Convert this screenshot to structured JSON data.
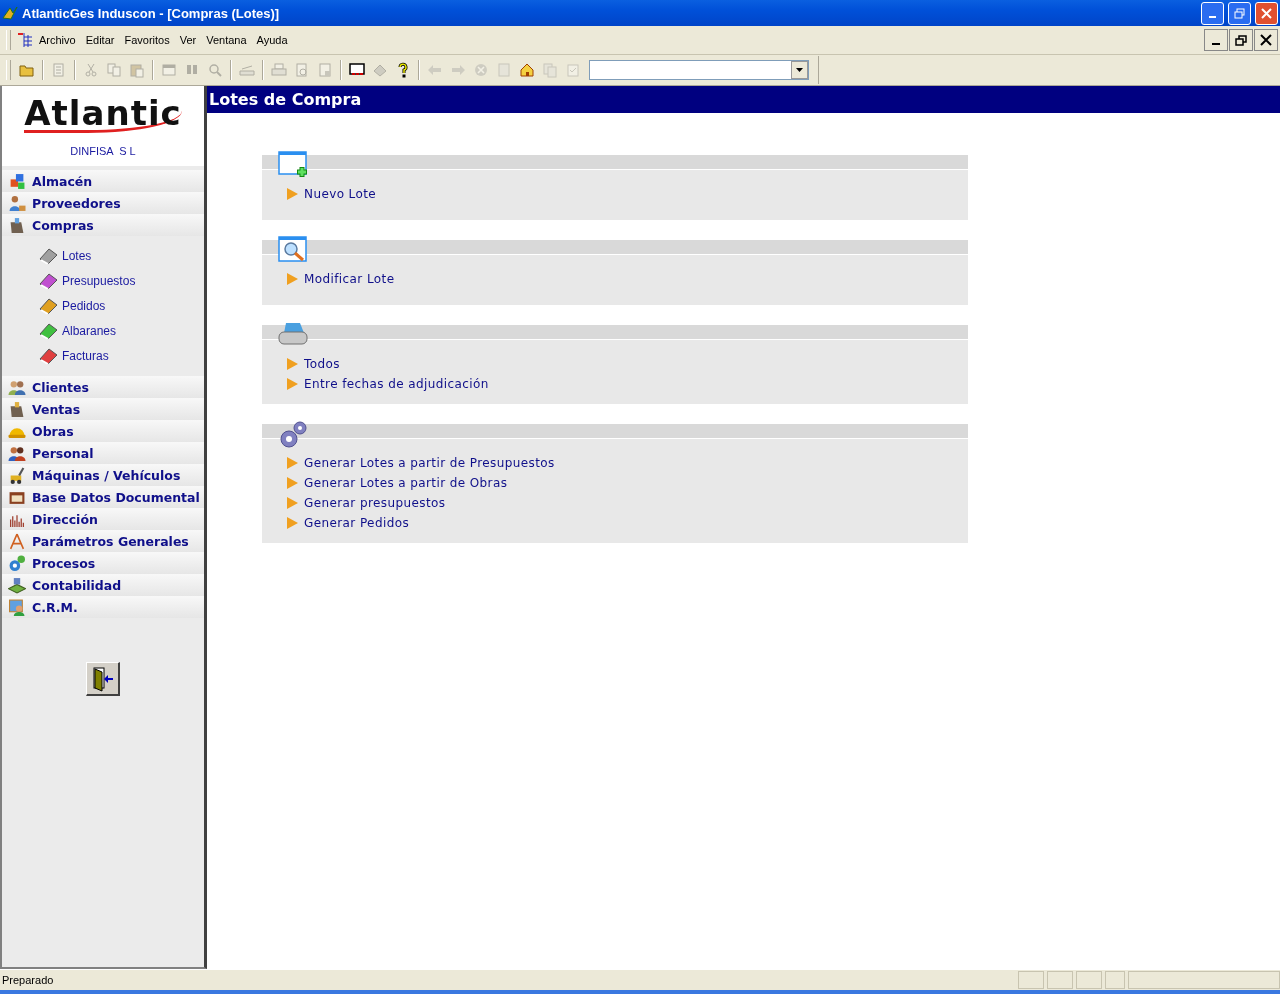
{
  "window": {
    "title": "AtlanticGes Induscon - [Compras (Lotes)]"
  },
  "menu": [
    "Archivo",
    "Editar",
    "Favoritos",
    "Ver",
    "Ventana",
    "Ayuda"
  ],
  "toolbar": [
    [
      {
        "disabled": false
      }
    ],
    [
      {
        "disabled": true
      }
    ],
    [
      {
        "disabled": true
      },
      {
        "disabled": true
      },
      {
        "disabled": true
      }
    ],
    [
      {
        "disabled": true
      },
      {
        "disabled": true
      },
      {
        "disabled": true
      }
    ],
    [
      {
        "disabled": true
      }
    ],
    [
      {
        "disabled": true
      },
      {
        "disabled": true
      },
      {
        "disabled": true
      }
    ],
    [
      {
        "disabled": false
      },
      {
        "disabled": true
      },
      {
        "disabled": false
      }
    ],
    [
      {
        "disabled": true
      },
      {
        "disabled": true
      },
      {
        "disabled": true
      },
      {
        "disabled": true
      },
      {
        "disabled": false
      },
      {
        "disabled": true
      },
      {
        "disabled": true
      }
    ]
  ],
  "sidebar": {
    "company": "DINFISA  S L",
    "logo": "Atlantic",
    "items": [
      {
        "label": "Almacén"
      },
      {
        "label": "Proveedores"
      },
      {
        "label": "Compras",
        "children": [
          {
            "label": "Lotes"
          },
          {
            "label": "Presupuestos"
          },
          {
            "label": "Pedidos"
          },
          {
            "label": "Albaranes"
          },
          {
            "label": "Facturas"
          }
        ]
      },
      {
        "label": "Clientes"
      },
      {
        "label": "Ventas"
      },
      {
        "label": "Obras"
      },
      {
        "label": "Personal"
      },
      {
        "label": "Máquinas / Vehículos"
      },
      {
        "label": "Base Datos Documental"
      },
      {
        "label": "Dirección"
      },
      {
        "label": "Parámetros Generales"
      },
      {
        "label": "Procesos"
      },
      {
        "label": "Contabilidad"
      },
      {
        "label": "C.R.M."
      }
    ]
  },
  "page": {
    "title": "Lotes de Compra",
    "sections": [
      {
        "links": [
          "Nuevo Lote"
        ]
      },
      {
        "links": [
          "Modificar Lote"
        ]
      },
      {
        "links": [
          "Todos",
          "Entre fechas de adjudicación"
        ]
      },
      {
        "links": [
          "Generar Lotes a partir de Presupuestos",
          "Generar Lotes a partir de Obras",
          "Generar presupuestos",
          "Generar Pedidos"
        ]
      }
    ]
  },
  "status_bar": {
    "text": "Preparado"
  }
}
